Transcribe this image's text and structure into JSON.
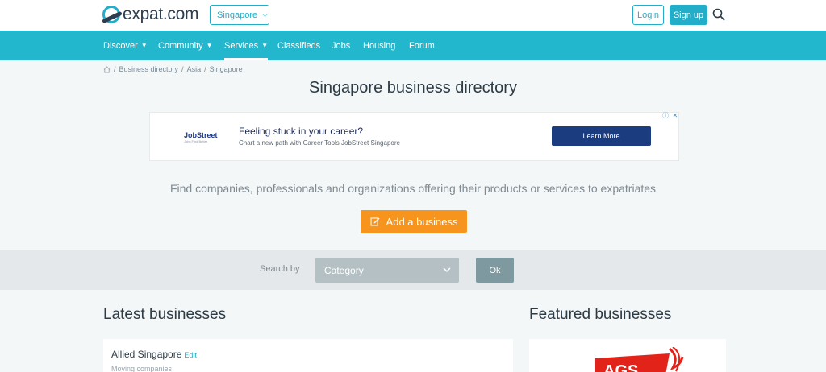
{
  "header": {
    "logo_text": "expat.com",
    "country": "Singapore",
    "login_label": "Login",
    "signup_label": "Sign up"
  },
  "nav": {
    "items": [
      {
        "label": "Discover",
        "dropdown": true
      },
      {
        "label": "Community",
        "dropdown": true
      },
      {
        "label": "Services",
        "dropdown": true,
        "active": true
      },
      {
        "label": "Classifieds",
        "dropdown": false
      },
      {
        "label": "Jobs",
        "dropdown": false
      },
      {
        "label": "Housing",
        "dropdown": false
      },
      {
        "label": "Forum",
        "dropdown": false
      }
    ]
  },
  "breadcrumb": [
    "Business directory",
    "Asia",
    "Singapore"
  ],
  "page_title": "Singapore business directory",
  "ad": {
    "brand": "JobStreet",
    "brand_tagline": "Jobs Find Better",
    "headline": "Feeling stuck in your career?",
    "subtext": "Chart a new path with Career Tools JobStreet Singapore",
    "cta": "Learn More"
  },
  "lead_text": "Find companies, professionals and organizations offering their products or services to expatriates",
  "add_business_label": "Add a business",
  "search": {
    "label": "Search by",
    "category_value": "Category",
    "ok_label": "Ok"
  },
  "latest": {
    "title": "Latest businesses",
    "items": [
      {
        "name": "Allied Singapore",
        "edit_label": "Edit",
        "category": "Moving companies"
      }
    ]
  },
  "featured": {
    "title": "Featured businesses",
    "logo_text": "AGS"
  },
  "colors": {
    "primary": "#22b7cc",
    "accent": "#f7941d",
    "text": "#2d3b45"
  }
}
